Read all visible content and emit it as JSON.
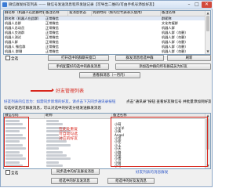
{
  "window": {
    "title": "微信群发好友列表 —— 微信号发送消息程序发送记录【可导出二维码/可由手机号添加好友】",
    "minimize": "–",
    "maximize": "□",
    "close": "✕"
  },
  "group_table": {
    "columns": [
      "群名称（机器人在此群时备注名称）",
      "备注名称",
      "发消息状态",
      "到期时间（如均空代表永久使用）",
      "备注名称"
    ],
    "rows": [
      {
        "name": "群名称（机器人在此群）",
        "remark": "正常微信",
        "status": "",
        "expire": "",
        "remark2": "群昵称"
      },
      {
        "name": "机器人总群",
        "remark": "正常微信",
        "status": "",
        "expire": "",
        "remark2": "文化传媒群"
      },
      {
        "name": "机器人总动员",
        "remark": "正常微信",
        "status": "",
        "expire": "",
        "remark2": "机器人群"
      },
      {
        "name": "机器人交流群",
        "remark": "正常微信",
        "status": "",
        "expire": "",
        "remark2": "机器人群（勿删）"
      },
      {
        "name": "机器人测试",
        "remark": "正常微信",
        "status": "",
        "expire": "",
        "remark2": "机器人群（勿删）"
      },
      {
        "name": "机器人群",
        "remark": "正常微信",
        "status": "",
        "expire": "",
        "remark2": "机器人群（勿删）"
      },
      {
        "name": "机器人 微信群",
        "remark": "正常微信",
        "status": "",
        "expire": "",
        "remark2": "机器人群（勿删）"
      },
      {
        "name": "机器人 群聊",
        "remark": "正常微信",
        "status": "",
        "expire": "",
        "remark2": "机器人群（勿删）"
      }
    ]
  },
  "group_controls": {
    "select_all": "全选",
    "open_group": "打开选中的群聊天窗口",
    "send_group_msg": "群发消息给选中群",
    "add_friend": "添加选中群的所有群成员为好友",
    "dialog_send": "手机配置好的选中的群发消息",
    "view_history": "查看群消息（一月内）",
    "refresh": "刷新"
  },
  "annotations": {
    "friend_list_arrow": "好友管理列表",
    "tip_blue": "好友列表的信息为：如需同步新增的好友，请点击下方同步通讯录按钮",
    "tip_black": "勾选好友后可群发消息，可以对选中的好友分组发送群发消息",
    "tip_right": "点击“通讯录”按钮 查看好友微信号 并批量添加到好友列表",
    "remark_callout": "在此处重复\n可自动勾选\n对应的好友"
  },
  "friend_table": {
    "columns": [
      "微信号码",
      "昵称",
      "备注名称"
    ],
    "rows": [
      {
        "wxid": "",
        "nick": "",
        "remark": ""
      },
      {
        "wxid": "",
        "nick": "",
        "remark": "小萌"
      },
      {
        "wxid": "",
        "nick": "",
        "remark": "小羊羊"
      },
      {
        "wxid": "",
        "nick": "",
        "remark": "小黄"
      },
      {
        "wxid": "",
        "nick": "",
        "remark": "Angel"
      },
      {
        "wxid": "",
        "nick": "",
        "remark": "小龙"
      },
      {
        "wxid": "",
        "nick": "",
        "remark": "小花"
      },
      {
        "wxid": "",
        "nick": "",
        "remark": "小王"
      },
      {
        "wxid": "",
        "nick": "",
        "remark": "小天"
      },
      {
        "wxid": "",
        "nick": "",
        "remark": "小路"
      },
      {
        "wxid": "",
        "nick": "",
        "remark": "小张"
      },
      {
        "wxid": "",
        "nick": "",
        "remark": "小雪"
      },
      {
        "wxid": "",
        "nick": "",
        "remark": "小丽"
      },
      {
        "wxid": "",
        "nick": "",
        "remark": "小可"
      }
    ]
  },
  "friend_controls": {
    "select_all": "全选",
    "send_to_friends": "同步选中的好友群发消息",
    "group_send": "好友列表的消息群发",
    "send_friends": "给选中的好友发消息",
    "select_all_friends": "给选中的好友发消息"
  }
}
